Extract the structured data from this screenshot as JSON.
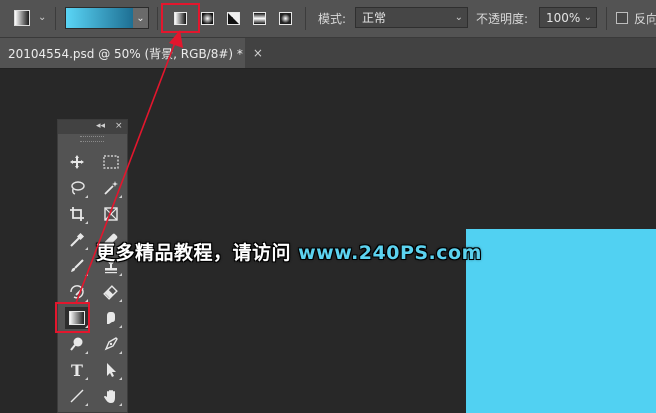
{
  "options_bar": {
    "mode_label": "模式:",
    "mode_value": "正常",
    "opacity_label": "不透明度:",
    "opacity_value": "100%",
    "reverse_label": "反向",
    "gradient_colors": [
      "#5ad5f6",
      "#1e6f93"
    ],
    "gradient_types": [
      "linear-gradient-icon",
      "radial-gradient-icon",
      "angle-gradient-icon",
      "reflected-gradient-icon",
      "diamond-gradient-icon"
    ],
    "selected_gradient_type": "linear-gradient-icon"
  },
  "document_tab": {
    "title": "20104554.psd @ 50% (背景, RGB/8#) *",
    "close_glyph": "×"
  },
  "toolbox": {
    "collapse_glyph": "◂◂",
    "close_glyph": "×",
    "tools": [
      "move-tool-icon",
      "marquee-tool-icon",
      "lasso-tool-icon",
      "magic-wand-tool-icon",
      "crop-tool-icon",
      "frame-tool-icon",
      "eyedropper-tool-icon",
      "healing-brush-tool-icon",
      "brush-tool-icon",
      "clone-stamp-tool-icon",
      "history-brush-tool-icon",
      "eraser-tool-icon",
      "gradient-tool-icon",
      "smudge-tool-icon",
      "dodge-tool-icon",
      "pen-tool-icon",
      "type-tool-icon",
      "path-selection-tool-icon",
      "line-tool-icon",
      "hand-tool-icon"
    ],
    "active_tool": "gradient-tool-icon",
    "type_glyph": "T"
  },
  "watermark": {
    "text_cn": "更多精品教程，请访问 ",
    "text_url": "www.240PS.com"
  },
  "colors": {
    "canvas_fill": "#51d1f2",
    "highlight_red": "#e3162d"
  }
}
